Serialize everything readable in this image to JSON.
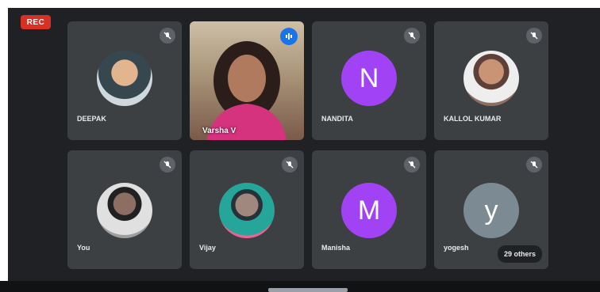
{
  "recording": {
    "label": "REC",
    "color": "#d93025"
  },
  "tiles": [
    {
      "name": "DEEPAK",
      "avatar_type": "photo",
      "muted": true
    },
    {
      "name": "Varsha V",
      "avatar_type": "video",
      "speaking": true
    },
    {
      "name": "NANDITA",
      "avatar_type": "letter",
      "letter": "N",
      "color": "#a142f4",
      "muted": true
    },
    {
      "name": "KALLOL KUMAR",
      "avatar_type": "photo",
      "muted": true
    },
    {
      "name": "You",
      "avatar_type": "photo",
      "muted": true
    },
    {
      "name": "Vijay",
      "avatar_type": "photo",
      "muted": true
    },
    {
      "name": "Manisha",
      "avatar_type": "letter",
      "letter": "M",
      "color": "#a142f4",
      "muted": true
    },
    {
      "name": "yogesh",
      "avatar_type": "letter",
      "letter": "y",
      "color": "#7c8b93",
      "muted": true
    }
  ],
  "others_label": "29 others",
  "icons": {
    "mute": "mic-off-icon",
    "speaking": "audio-level-icon"
  }
}
